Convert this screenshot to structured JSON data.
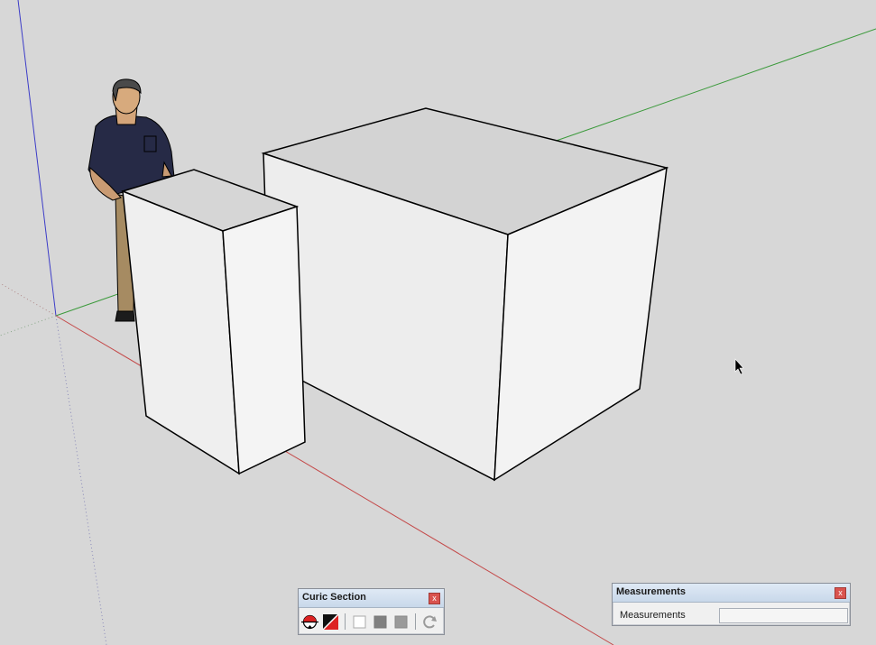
{
  "toolbars": {
    "curic": {
      "title": "Curic Section",
      "close_label": "x",
      "icons": [
        "section-plane-icon",
        "section-fill-icon",
        "white-fill-icon",
        "gray-fill-icon",
        "light-gray-fill-icon",
        "refresh-icon"
      ]
    },
    "measurements": {
      "title": "Measurements",
      "close_label": "x",
      "field_label": "Measurements",
      "value": ""
    }
  },
  "colors": {
    "background": "#d7d7d7",
    "red_axis": "#c44a4a",
    "green_axis": "#3c9a3c",
    "blue_axis": "#3c3cc8",
    "box_face_light": "#f1f1f1",
    "box_face_top": "#d3d3d3"
  },
  "scene": {
    "objects": [
      "person-figure",
      "small-box",
      "large-box",
      "cursor-pointer"
    ]
  }
}
